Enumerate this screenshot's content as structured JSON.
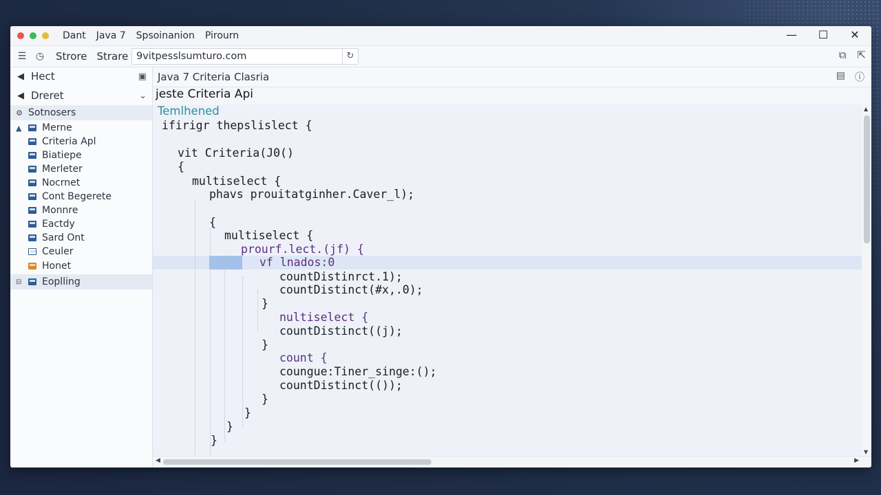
{
  "titlebar": {
    "menu": [
      "Dant",
      "Java 7",
      "Spsoinanion",
      "Pirourn"
    ],
    "controls": {
      "minimize": "—",
      "maximize": "☐",
      "close": "✕"
    }
  },
  "toolbar": {
    "store_label": "Strore",
    "share_label": "Strare",
    "url": "9vitpesslsumturo.com"
  },
  "sidebar": {
    "header1": "Hect",
    "header2": "Dreret",
    "section": "Sotnosers",
    "items": [
      {
        "label": "Merne"
      },
      {
        "label": "Criteria Apl"
      },
      {
        "label": "Biatiepe"
      },
      {
        "label": "Merleter"
      },
      {
        "label": "Nocrnet"
      },
      {
        "label": "Cont Begerete"
      },
      {
        "label": "Monnre"
      },
      {
        "label": "Eactdy"
      },
      {
        "label": "Sard Ont"
      },
      {
        "label": "Ceuler"
      },
      {
        "label": "Honet"
      },
      {
        "label": "Eoplling"
      }
    ]
  },
  "editor": {
    "tab_title": "Java 7 Criteria Clasria",
    "file_title": "jeste Criteria Api",
    "lines": [
      "Temlhened",
      "ifirigr thepslislect {",
      "vit Criteria(J0()",
      "{",
      "multiselect {",
      "phavs prouitatginher.Caver_l);",
      "{",
      "multiselect {",
      "prourf.lect.(jf) {",
      "vf lnados:0",
      "countDistinrct.1);",
      "countDistinct(#x,.0);",
      "}",
      "nultiselect {",
      "countDistinct((j);",
      "}",
      "count {",
      "coungue:Tiner_singe:();",
      "countDistinct(());",
      "}",
      "}",
      "}",
      "}"
    ]
  }
}
